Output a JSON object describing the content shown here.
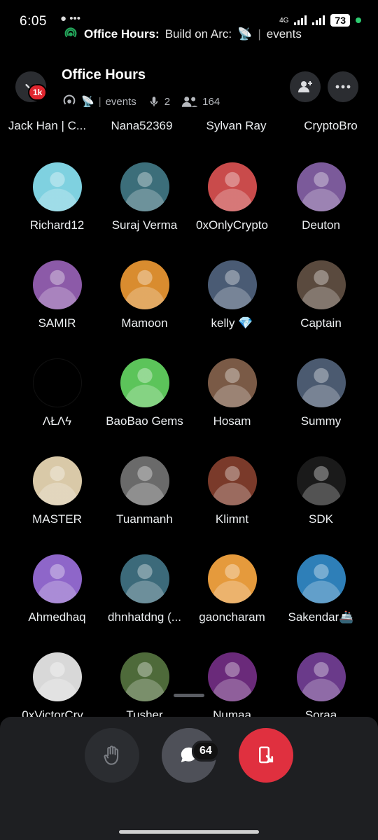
{
  "statusbar": {
    "time": "6:05",
    "left_icons": "•••",
    "net": "4G",
    "battery": "73",
    "event_bold": "Office Hours:",
    "event_rest": "Build on Arc:",
    "event_channel": "events"
  },
  "header": {
    "title": "Office Hours",
    "badge": "1k",
    "channel": "events",
    "speakers": "2",
    "listeners": "164"
  },
  "top_names": [
    "Jack Han | C...",
    "Nana52369",
    "Sylvan Ray",
    "CryptoBro"
  ],
  "rows": [
    [
      {
        "name": "Richard12",
        "color": "#7fd1e0"
      },
      {
        "name": "Suraj Verma",
        "color": "#3c6e7a"
      },
      {
        "name": "0xOnlyCrypto",
        "color": "#c94b4b"
      },
      {
        "name": "Deuton",
        "color": "#7b5a9a"
      }
    ],
    [
      {
        "name": "SAMIR",
        "color": "#8c5aa8"
      },
      {
        "name": "Mamoon",
        "color": "#d98c2f"
      },
      {
        "name": "kelly 💎",
        "color": "#4a5b74"
      },
      {
        "name": "Captain",
        "color": "#5a4a3e"
      }
    ],
    [
      {
        "name": "ΛŁΛϟ",
        "color": "#000000"
      },
      {
        "name": "BaoBao Gems",
        "color": "#5cc45a"
      },
      {
        "name": "Hosam",
        "color": "#7a5a46"
      },
      {
        "name": "Summy",
        "color": "#4b5a70"
      }
    ],
    [
      {
        "name": "MASTER",
        "color": "#d9c9a8"
      },
      {
        "name": "Tuanmanh",
        "color": "#6a6a6a"
      },
      {
        "name": "Klimnt",
        "color": "#7a3a2a"
      },
      {
        "name": "SDK",
        "color": "#1a1a1a"
      }
    ],
    [
      {
        "name": "Ahmedhaq",
        "color": "#8e66c9"
      },
      {
        "name": "dhnhatdng (...",
        "color": "#3c6a7a"
      },
      {
        "name": "gaoncharam",
        "color": "#e59a3c"
      },
      {
        "name": "Sakendar🚢",
        "color": "#2e7fb8"
      }
    ],
    [
      {
        "name": "0xVictorCry...",
        "color": "#d8d8d8"
      },
      {
        "name": "Tusher",
        "color": "#4e6a3a"
      },
      {
        "name": "Numaa",
        "color": "#6a2a7a"
      },
      {
        "name": "Soraa",
        "color": "#6a3a8a"
      }
    ]
  ],
  "controls": {
    "chat_count": "64"
  },
  "colors": {
    "leave_red": "#e0303f",
    "panel": "#1e1f22",
    "control_grey": "#35373c"
  }
}
